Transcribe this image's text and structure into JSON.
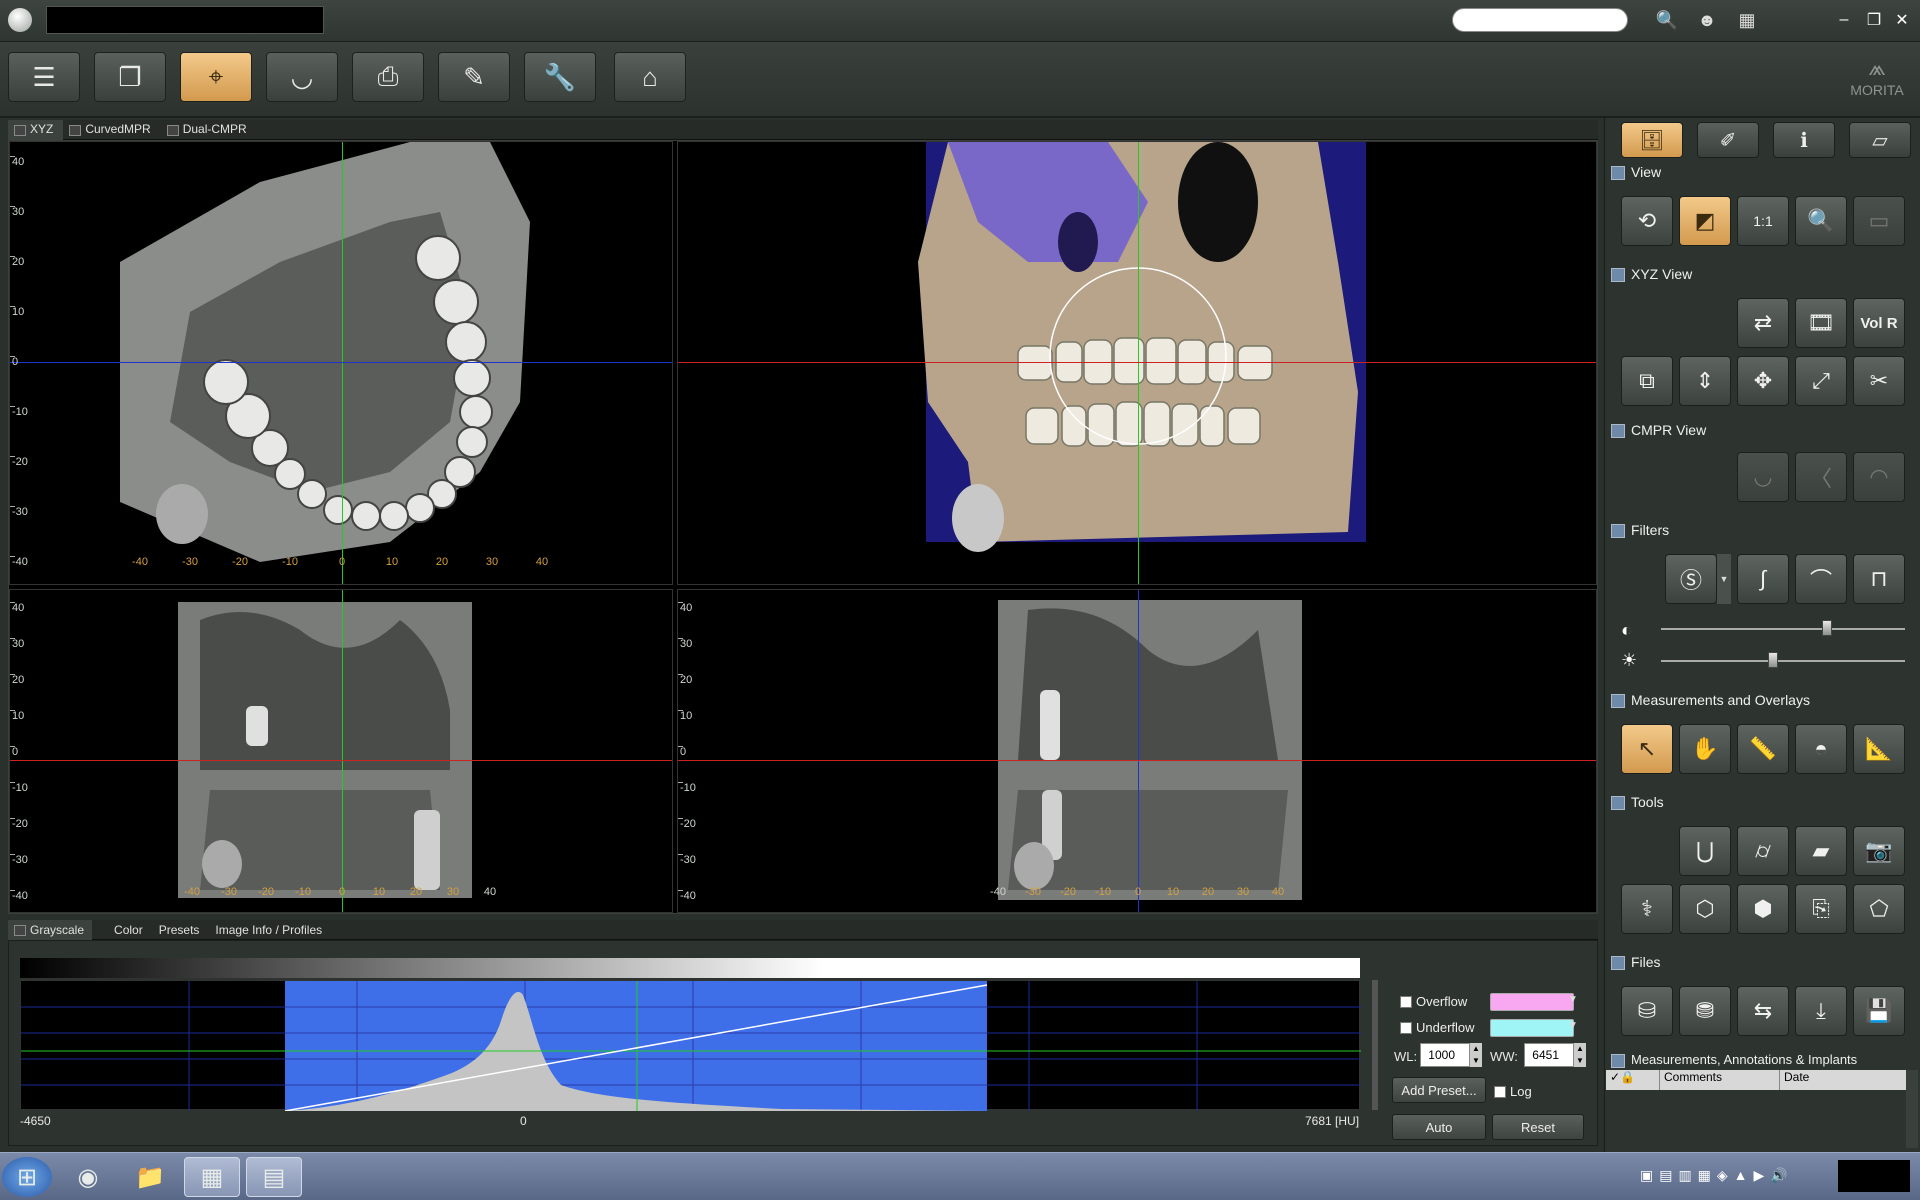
{
  "titlebar": {
    "title": "",
    "search_placeholder": ""
  },
  "toolbar": {
    "buttons": [
      "list-view",
      "windows",
      "xyz-volume",
      "panoramic",
      "print",
      "report",
      "settings",
      "home"
    ],
    "active": "xyz-volume"
  },
  "logo": {
    "text": "MORITA"
  },
  "view_tabs": [
    {
      "label": "XYZ",
      "active": true
    },
    {
      "label": "CurvedMPR",
      "active": false
    },
    {
      "label": "Dual-CMPR",
      "active": false
    }
  ],
  "panes": {
    "axial": {
      "v_ticks": [
        "40",
        "30",
        "20",
        "10",
        "0",
        "-10",
        "-20",
        "-30",
        "-40"
      ],
      "h_ticks": [
        "-40",
        "-30",
        "-20",
        "-10",
        "0",
        "10",
        "20",
        "30",
        "40"
      ]
    },
    "coronal": {
      "v_ticks": [
        "40",
        "30",
        "20",
        "10",
        "0",
        "-10",
        "-20",
        "-30",
        "-40"
      ],
      "h_ticks": [
        "-40",
        "-30",
        "-20",
        "-10",
        "0",
        "10",
        "20",
        "30",
        "40"
      ]
    },
    "sagittal": {
      "v_ticks": [
        "40",
        "30",
        "20",
        "10",
        "0",
        "-10",
        "-20",
        "-30",
        "-40"
      ],
      "h_ticks": [
        "-40",
        "-30",
        "-20",
        "-10",
        "0",
        "10",
        "20",
        "30",
        "40"
      ]
    }
  },
  "bottom_tabs": [
    {
      "label": "Grayscale",
      "active": true
    },
    {
      "label": "Color",
      "active": false
    },
    {
      "label": "Presets",
      "active": false
    },
    {
      "label": "Image Info / Profiles",
      "active": false
    }
  ],
  "histogram": {
    "min_label": "-4650",
    "zero_label": "0",
    "max_label": "7681 [HU]",
    "overflow_label": "Overflow",
    "underflow_label": "Underflow",
    "overflow_color": "#f7a8f0",
    "underflow_color": "#9ff5f5",
    "wl_label": "WL:",
    "wl_value": "1000",
    "ww_label": "WW:",
    "ww_value": "6451",
    "add_preset": "Add Preset...",
    "log_label": "Log",
    "auto": "Auto",
    "reset": "Reset"
  },
  "right_panel": {
    "sections": {
      "view": "View",
      "xyz_view": "XYZ View",
      "cmpr_view": "CMPR View",
      "filters": "Filters",
      "measurements": "Measurements and Overlays",
      "tools": "Tools",
      "files": "Files",
      "annotations": "Measurements, Annotations & Implants"
    },
    "volr_label": "Vol R",
    "one_to_one": "1:1",
    "list_columns": {
      "comments": "Comments",
      "date": "Date"
    },
    "contrast_level": 0.68,
    "brightness_level": 0.46
  },
  "colors": {
    "accent": "#e0ac62",
    "crosshair_green": "#22cc22",
    "crosshair_blue": "#2233cc",
    "crosshair_red": "#cc2222",
    "window_blue": "#3f6fe8"
  }
}
